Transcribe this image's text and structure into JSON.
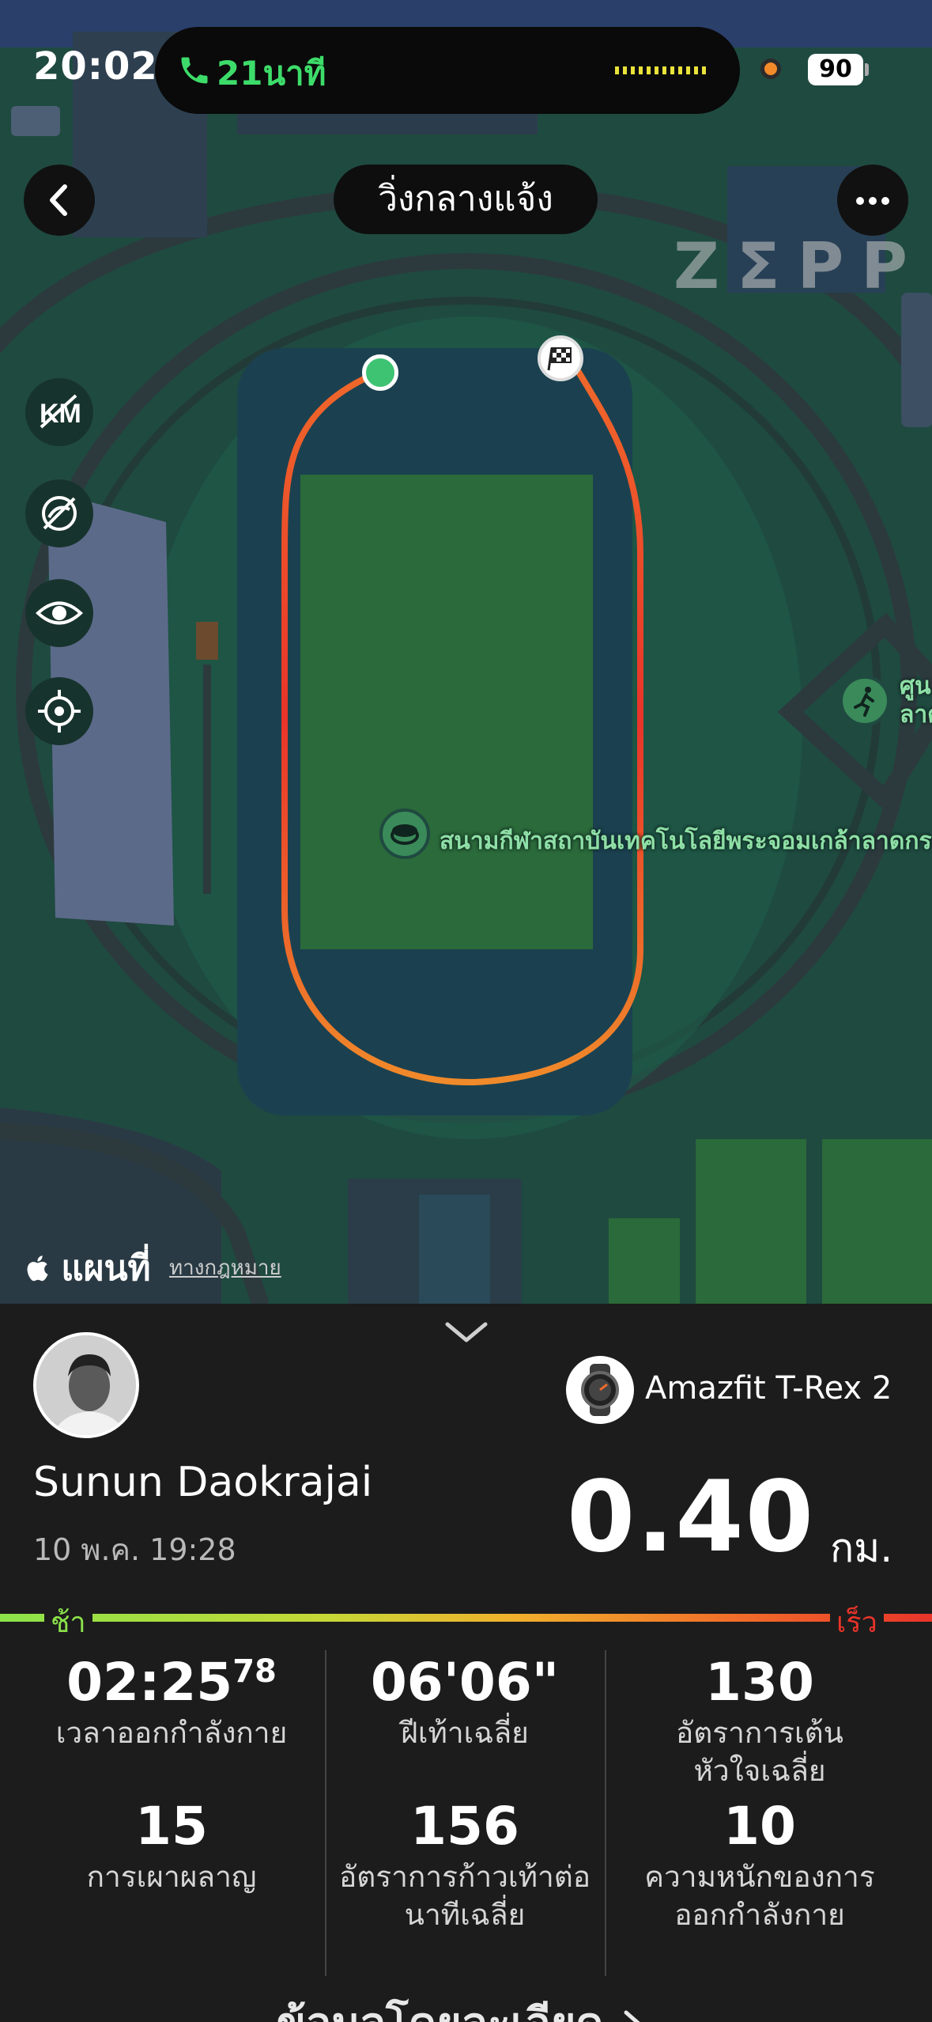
{
  "status_bar": {
    "time": "20:02",
    "call_duration": "21นาที",
    "battery": "90"
  },
  "header": {
    "title": "วิ่งกลางแจ้ง",
    "brand": "ZΣPP"
  },
  "map": {
    "poi_stadium": "สนามกีฬาสถาบันเทคโนโลยีพระจอมเกล้าลาดกระ",
    "poi_center": "ศูน\nลาด",
    "apple_maps": "แผนที่",
    "legal": "ทางกฎหมาย",
    "side_controls": [
      "km-icon",
      "hide-track-icon",
      "eye-icon",
      "locate-icon"
    ]
  },
  "workout": {
    "user_name": "Sunun Daokrajai",
    "date": "10 พ.ค. 19:28",
    "device": "Amazfit T-Rex 2",
    "distance": "0.40",
    "unit": "กม.",
    "pace_slow": "ช้า",
    "pace_fast": "เร็ว",
    "stats": [
      {
        "value": "02:25",
        "value_sup": "78",
        "label": "เวลาออกกำลังกาย"
      },
      {
        "value": "06'06\"",
        "label": "ฝีเท้าเฉลี่ย"
      },
      {
        "value": "130",
        "label": "อัตราการเต้น\nหัวใจเฉลี่ย"
      },
      {
        "value": "15",
        "label": "การเผาผลาญ"
      },
      {
        "value": "156",
        "label": "อัตราการก้าวเท้าต่อ\nนาทีเฉลี่ย"
      },
      {
        "value": "10",
        "label": "ความหนักของการ\nออกกำลังกาย"
      }
    ],
    "details_link": "ข้อมูลโดยละเอียด"
  },
  "colors": {
    "accent_green": "#3ddc6a",
    "route_start": "#e8342a",
    "route_end": "#f08a2a",
    "map_bg": "#1f4a40"
  }
}
